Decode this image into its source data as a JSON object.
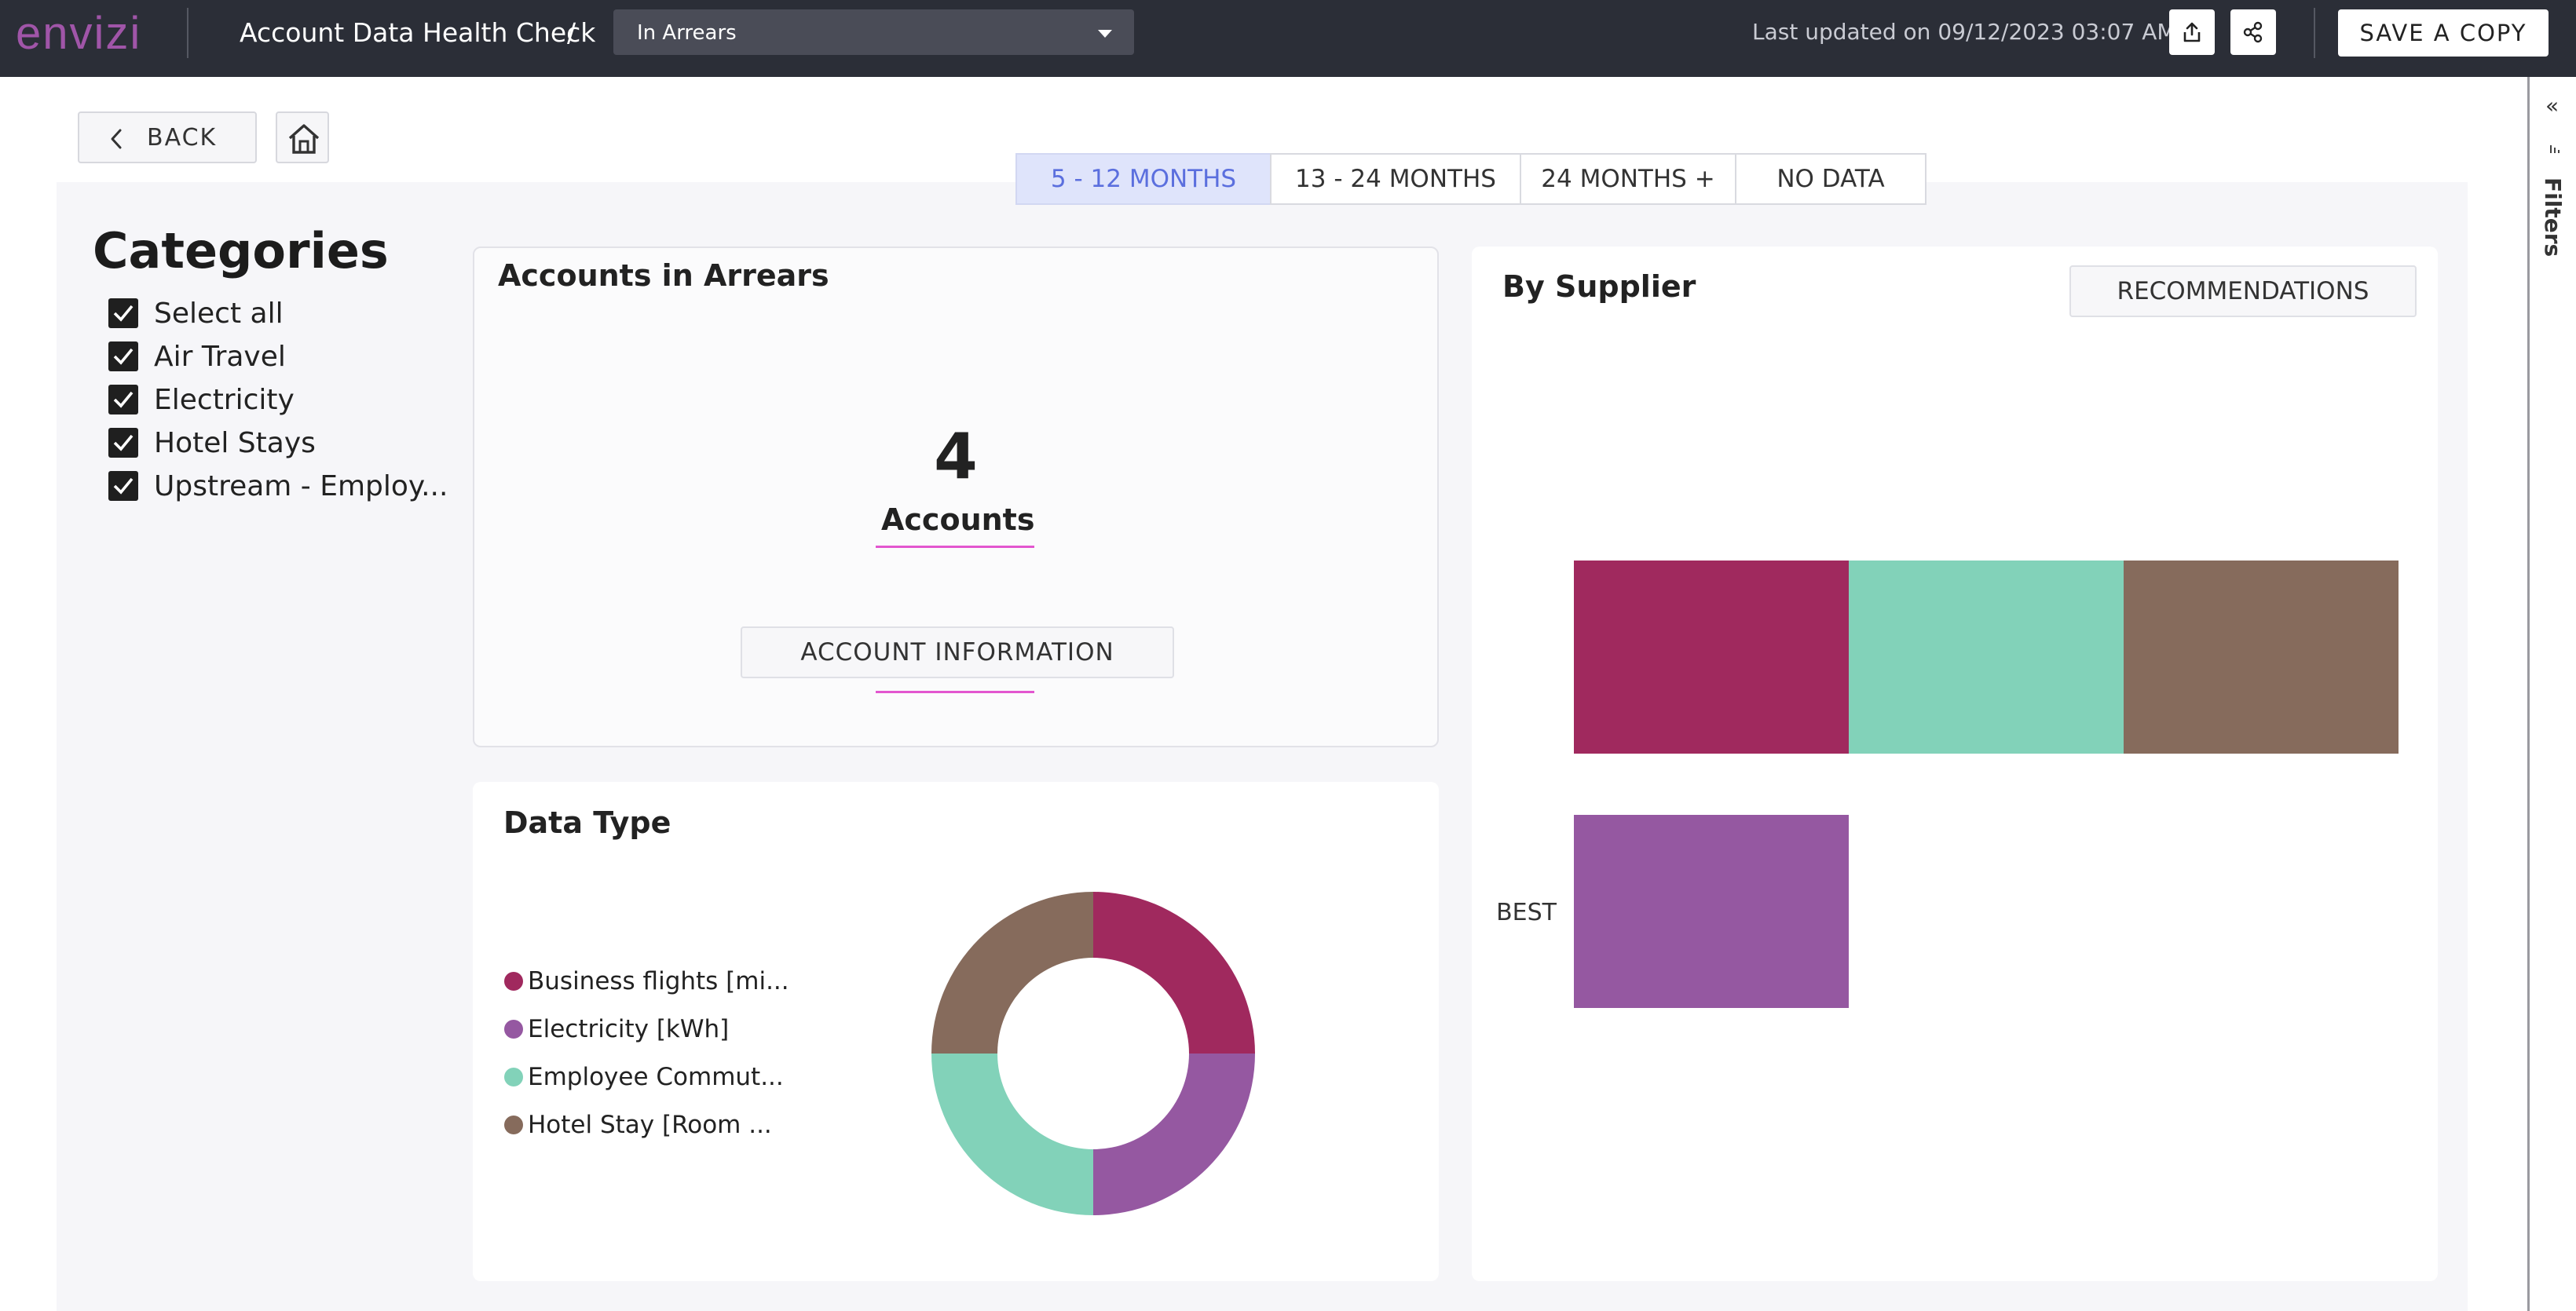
{
  "topbar": {
    "logo": "envizi",
    "title": "Account Data Health Check",
    "separator": "/",
    "view_select": "In Arrears",
    "last_updated": "Last updated on 09/12/2023 03:07 AM",
    "save_copy_label": "SAVE A COPY",
    "export_icon": "export-icon",
    "share_icon": "share-icon"
  },
  "nav": {
    "back_label": "BACK",
    "home_icon": "home-icon"
  },
  "tabs": [
    {
      "label": "5 - 12 MONTHS",
      "active": true
    },
    {
      "label": "13 - 24 MONTHS",
      "active": false
    },
    {
      "label": "24 MONTHS +",
      "active": false
    },
    {
      "label": "NO DATA",
      "active": false
    }
  ],
  "categories": {
    "title": "Categories",
    "items": [
      {
        "label": "Select all",
        "checked": true
      },
      {
        "label": "Air Travel",
        "checked": true
      },
      {
        "label": "Electricity",
        "checked": true
      },
      {
        "label": "Hotel Stays",
        "checked": true
      },
      {
        "label": "Upstream - Employ...",
        "checked": true
      }
    ]
  },
  "accounts_card": {
    "title": "Accounts in Arrears",
    "count": "4",
    "count_label": "Accounts",
    "button_label": "ACCOUNT INFORMATION"
  },
  "datatype_card": {
    "title": "Data Type",
    "legend": [
      {
        "label": "Business flights [mi...",
        "color": "#a0295e"
      },
      {
        "label": "Electricity [kWh]",
        "color": "#9558a1"
      },
      {
        "label": "Employee Commut...",
        "color": "#82d2b9"
      },
      {
        "label": "Hotel Stay [Room ...",
        "color": "#866b5c"
      }
    ]
  },
  "supplier_card": {
    "title": "By Supplier",
    "button_label": "RECOMMENDATIONS"
  },
  "side_panel": {
    "filters_label": "Filters",
    "collapse_icon": "double-chevron-left-icon"
  },
  "chart_data": [
    {
      "type": "pie",
      "title": "Data Type",
      "categories": [
        "Business flights [mi...",
        "Electricity [kWh]",
        "Employee Commut...",
        "Hotel Stay [Room ..."
      ],
      "values": [
        1,
        1,
        1,
        1
      ],
      "colors": [
        "#a0295e",
        "#9558a1",
        "#82d2b9",
        "#866b5c"
      ],
      "donut": true
    },
    {
      "type": "bar",
      "orientation": "horizontal",
      "stacked": true,
      "title": "By Supplier",
      "categories": [
        "",
        "BEST"
      ],
      "series": [
        {
          "values": [
            1,
            1
          ],
          "color_per_row": [
            "#a0295e",
            "#9558a1"
          ]
        },
        {
          "values": [
            1,
            0
          ],
          "color": "#82d2b9"
        },
        {
          "values": [
            1,
            0
          ],
          "color": "#866b5c"
        }
      ],
      "xlim": [
        0,
        3
      ],
      "grid": false,
      "axes_visible": false
    }
  ]
}
